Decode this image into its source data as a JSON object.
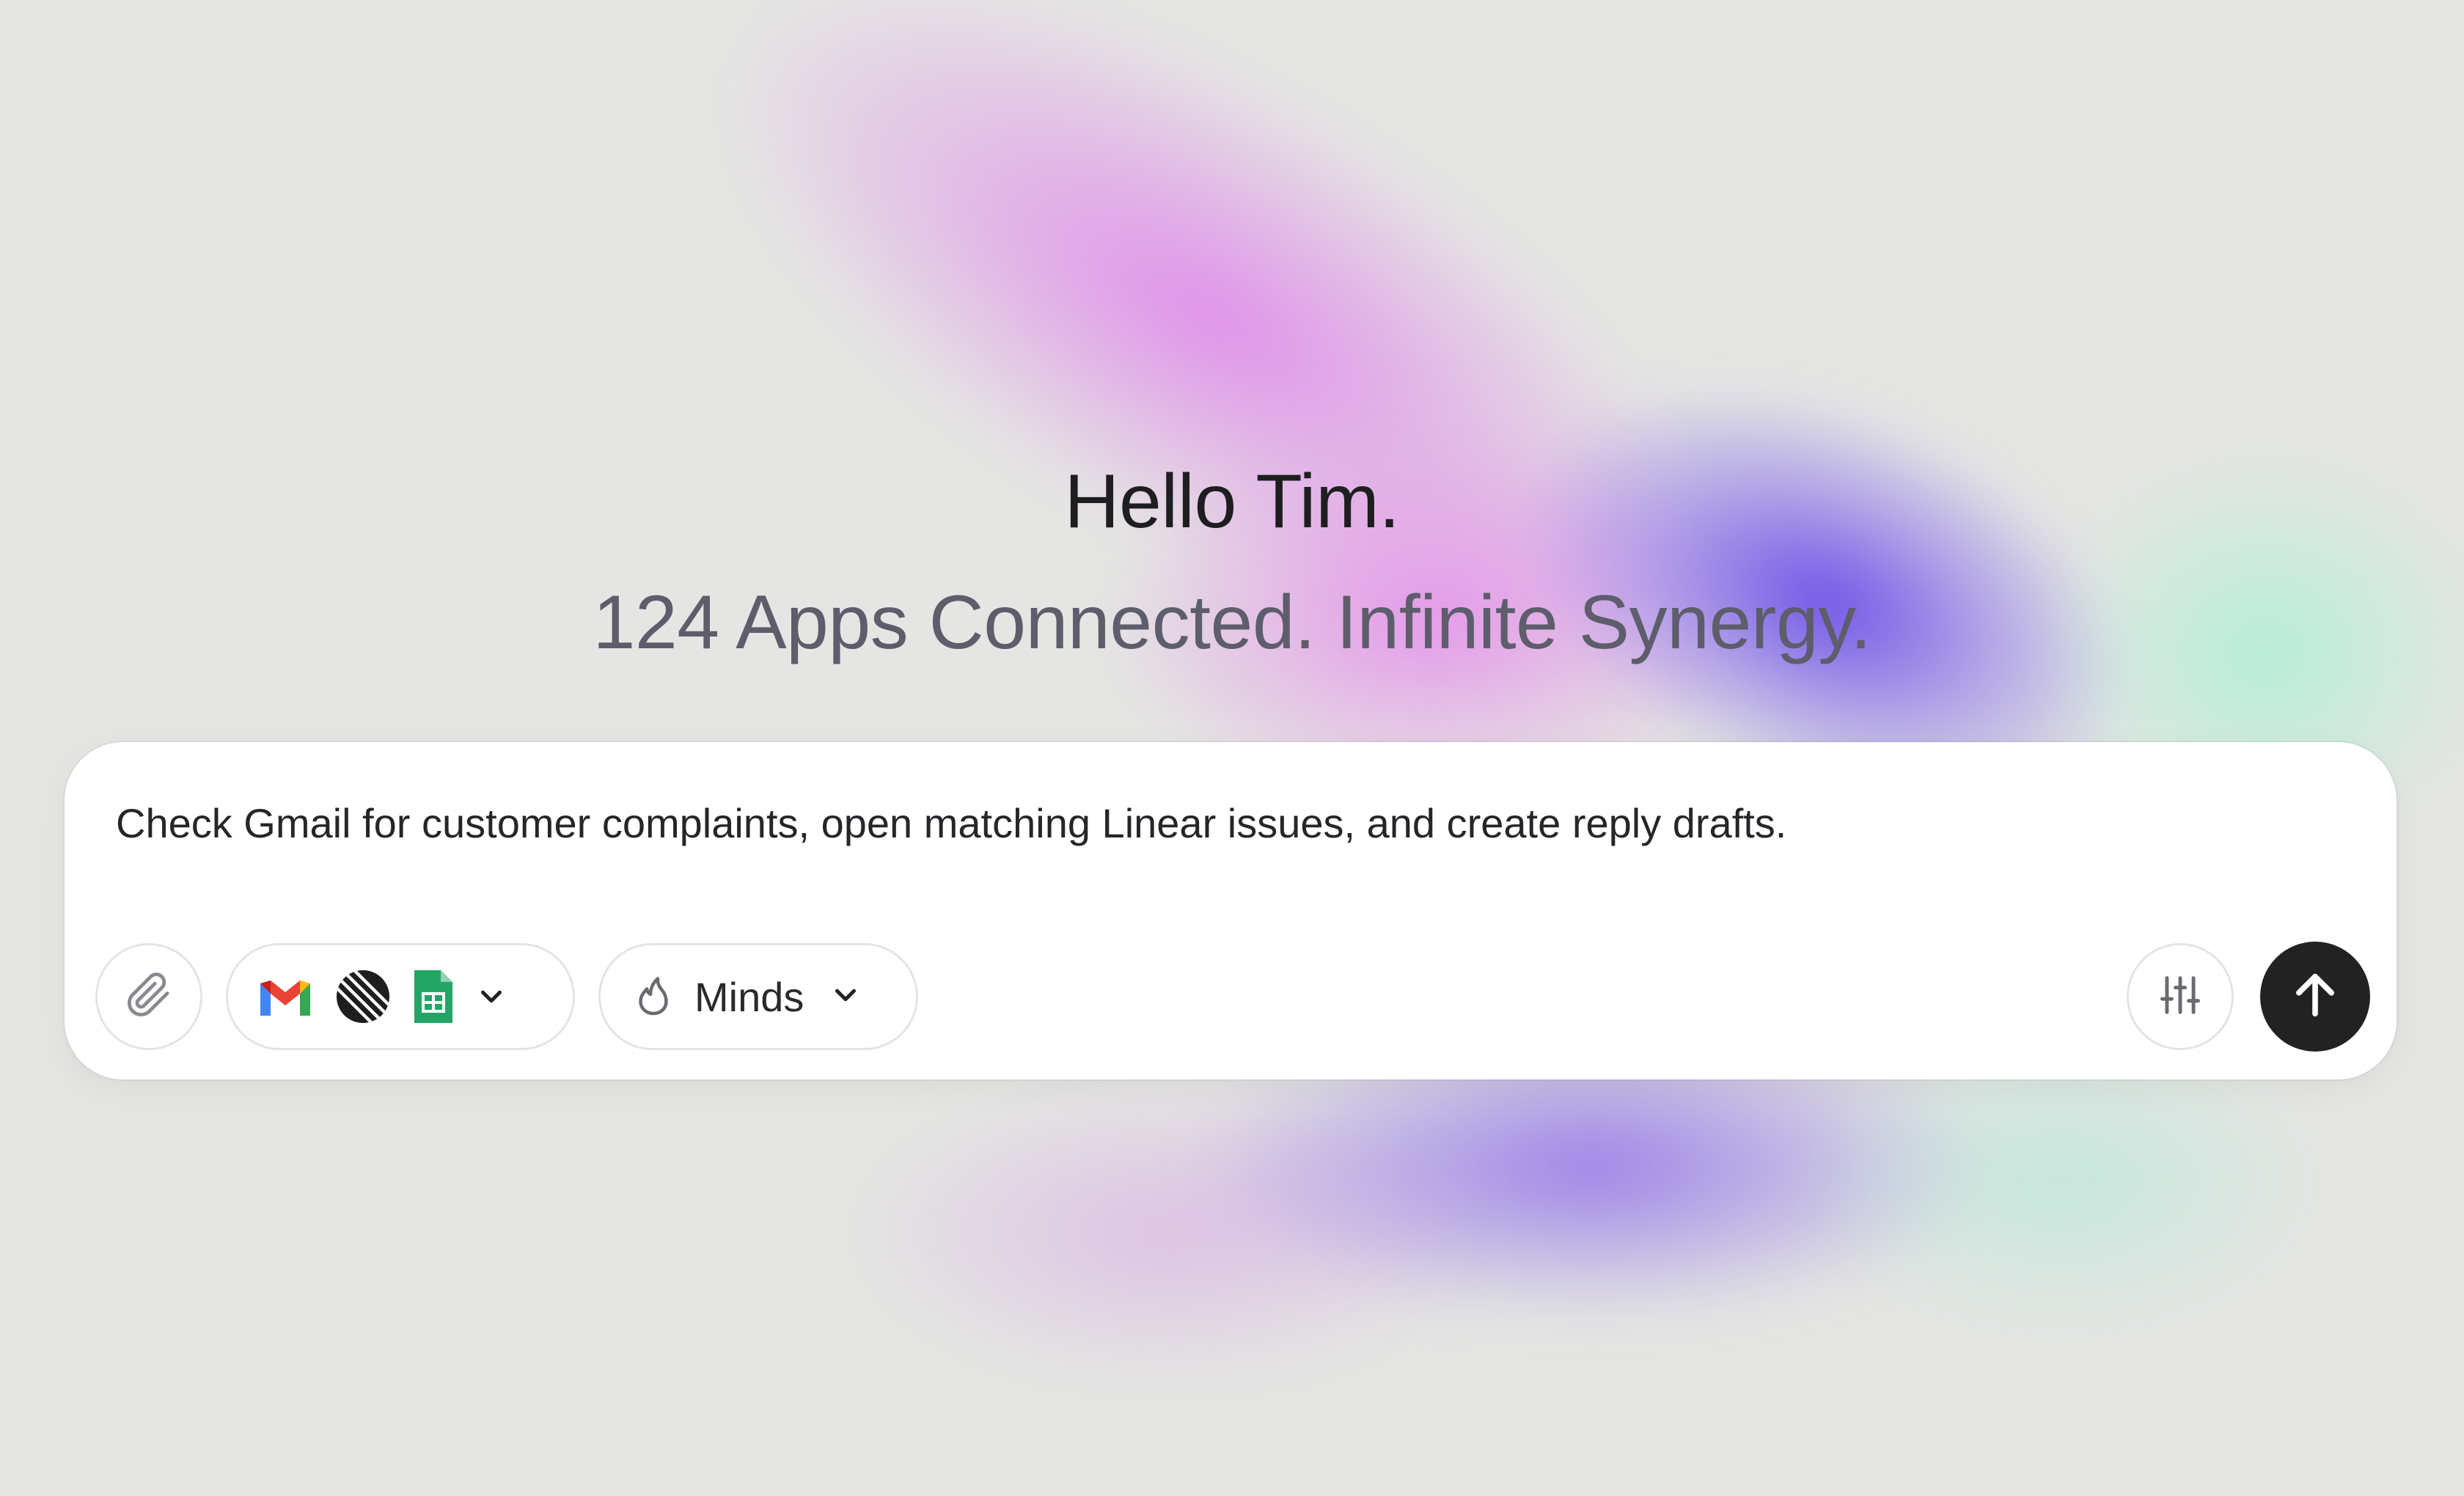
{
  "greeting": "Hello Tim.",
  "tagline": "124 Apps Connected. Infinite Synergy.",
  "composer": {
    "prompt_text": "Check Gmail for customer complaints, open matching Linear issues, and create reply drafts.",
    "connected_apps": [
      "gmail-icon",
      "linear-icon",
      "google-sheets-icon"
    ],
    "mode_label": "Minds",
    "mode_icon": "flame-icon",
    "attach_icon": "paperclip-icon",
    "settings_icon": "sliders-icon",
    "send_icon": "arrow-up-icon"
  },
  "colors": {
    "background": "#e5e6e3",
    "send_button": "#222222",
    "heading": "#1e1e20",
    "subheading": "#5d5d6b"
  }
}
